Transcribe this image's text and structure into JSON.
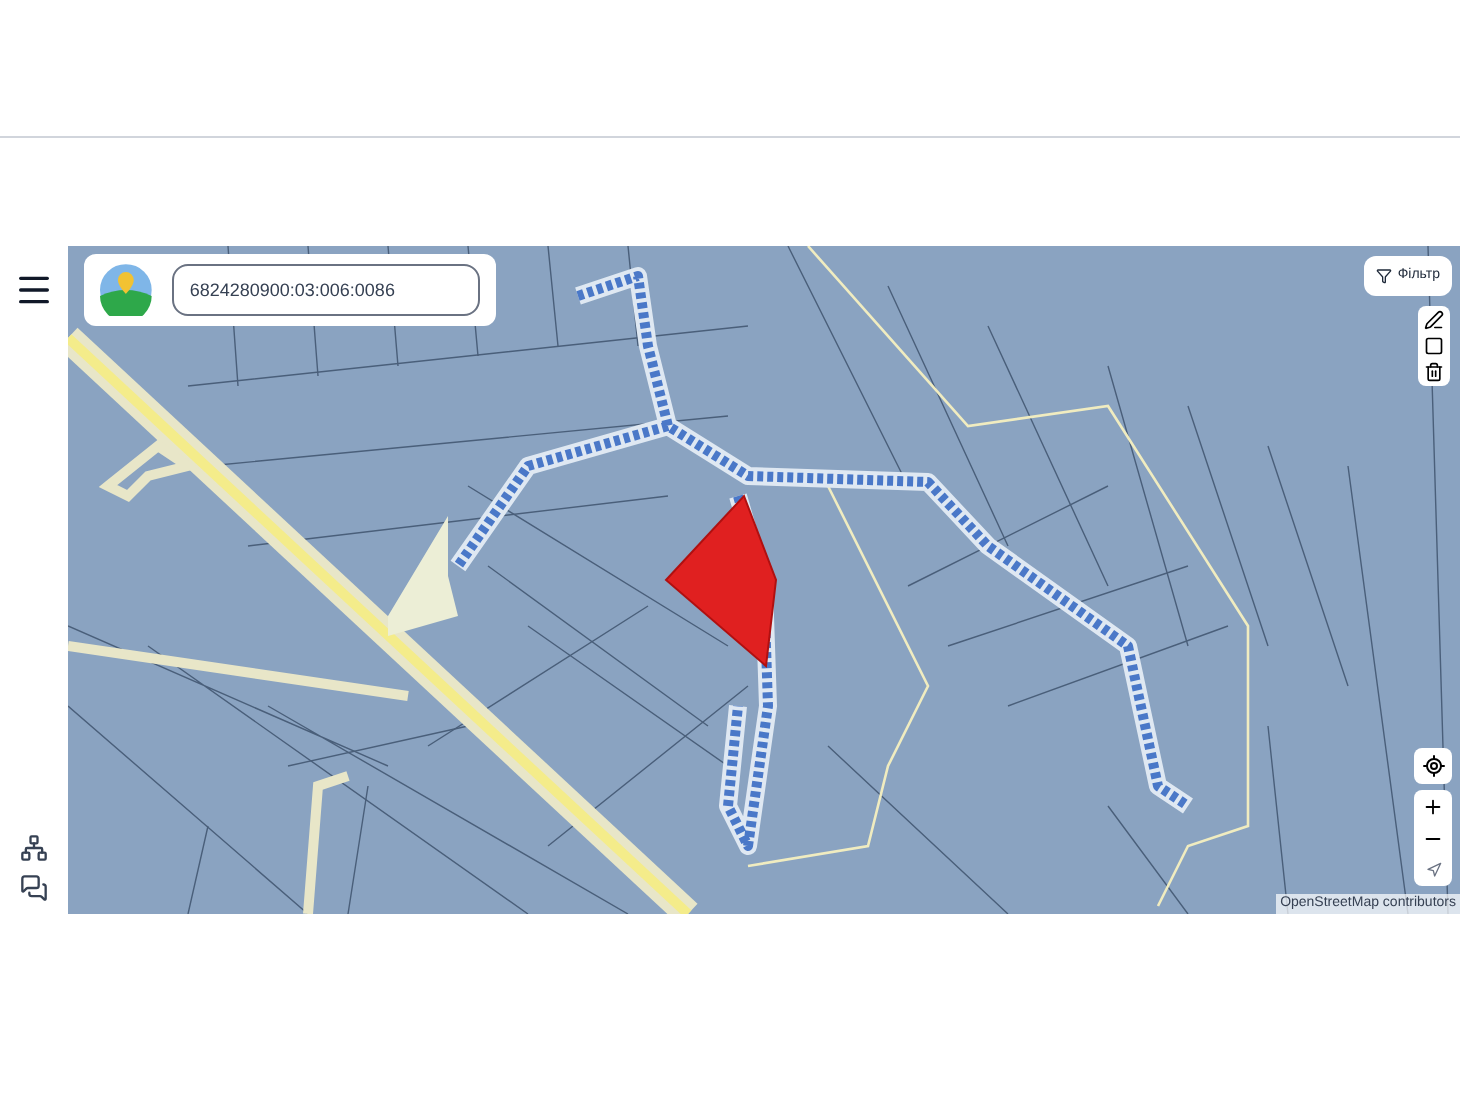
{
  "search": {
    "value": "6824280900:03:006:0086"
  },
  "filter_button": {
    "label": "Фільтр"
  },
  "attribution": "OpenStreetMap contributors"
}
